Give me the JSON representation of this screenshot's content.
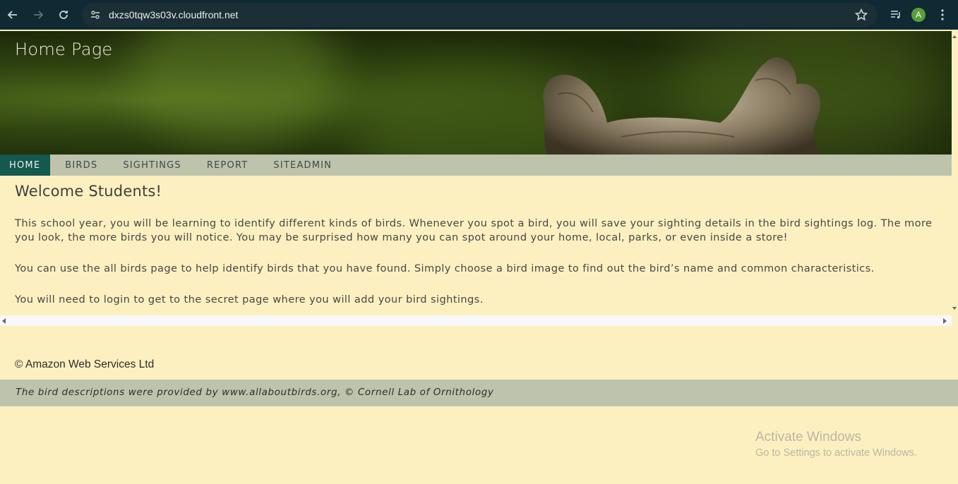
{
  "browser": {
    "url": "dxzs0tqw3s03v.cloudfront.net",
    "profile_initial": "A",
    "profile_color": "#5a9e3a",
    "icons": {
      "back": "back-arrow-icon",
      "forward": "forward-arrow-icon",
      "reload": "reload-icon",
      "site_info": "tune-icon",
      "bookmark": "star-icon",
      "media": "media-control-icon",
      "menu": "three-dots-icon"
    }
  },
  "header": {
    "title": "Home Page"
  },
  "nav": {
    "items": [
      {
        "label": "HOME",
        "active": true
      },
      {
        "label": "BIRDS",
        "active": false
      },
      {
        "label": "SIGHTINGS",
        "active": false
      },
      {
        "label": "REPORT",
        "active": false
      },
      {
        "label": "SITEADMIN",
        "active": false
      }
    ],
    "active_color": "#14584e",
    "bar_color": "#bec3ab"
  },
  "main": {
    "heading": "Welcome Students!",
    "paragraphs": [
      "This school year, you will be learning to identify different kinds of birds. Whenever you spot a bird, you will save your sighting details in the bird sightings log. The more you look, the more birds you will notice. You may be surprised how many you can spot around your home, local, parks, or even inside a store!",
      "You can use the all birds page to help identify birds that you have found. Simply choose a bird image to find out the bird’s name and common characteristics.",
      "You will need to login to get to the secret page where you will add your bird sightings."
    ],
    "background": "#fdf0c0"
  },
  "footer": {
    "copyright": "© Amazon Web Services Ltd",
    "credit": "The bird descriptions were provided by www.allaboutbirds.org, © Cornell Lab of Ornithology"
  },
  "watermark": {
    "title": "Activate Windows",
    "subtitle": "Go to Settings to activate Windows."
  }
}
